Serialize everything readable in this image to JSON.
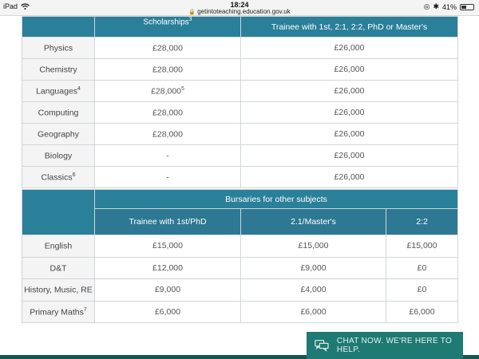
{
  "statusbar": {
    "device": "iPad",
    "time": "18:24",
    "url": "getintoteaching.education.gov.uk",
    "battery": "41%",
    "battery_level": 0.41
  },
  "scholarships_table": {
    "header_partial": "Scholarships",
    "header_partial_note": "3",
    "trainee_header": "Trainee with 1st, 2:1, 2:2, PhD or Master's",
    "rows": [
      {
        "subject": "Physics",
        "note": "",
        "scholarship": "£28,000",
        "scholarship_note": "",
        "bursary": "£26,000"
      },
      {
        "subject": "Chemistry",
        "note": "",
        "scholarship": "£28,000",
        "scholarship_note": "",
        "bursary": "£26,000"
      },
      {
        "subject": "Languages",
        "note": "4",
        "scholarship": "£28,000",
        "scholarship_note": "5",
        "bursary": "£26,000"
      },
      {
        "subject": "Computing",
        "note": "",
        "scholarship": "£28,000",
        "scholarship_note": "",
        "bursary": "£26,000"
      },
      {
        "subject": "Geography",
        "note": "",
        "scholarship": "£28,000",
        "scholarship_note": "",
        "bursary": "£26,000"
      },
      {
        "subject": "Biology",
        "note": "",
        "scholarship": "-",
        "scholarship_note": "",
        "bursary": "£26,000"
      },
      {
        "subject": "Classics",
        "note": "6",
        "scholarship": "-",
        "scholarship_note": "",
        "bursary": "£26,000"
      }
    ]
  },
  "bursaries_table": {
    "title": "Bursaries for other subjects",
    "columns": [
      "Trainee with 1st/PhD",
      "2.1/Master's",
      "2:2"
    ],
    "rows": [
      {
        "subject": "English",
        "note": "",
        "values": [
          "£15,000",
          "£15,000",
          "£15,000"
        ]
      },
      {
        "subject": "D&T",
        "note": "",
        "values": [
          "£12,000",
          "£9,000",
          "£0"
        ]
      },
      {
        "subject": "History, Music, RE",
        "note": "",
        "values": [
          "£9,000",
          "£4,000",
          "£0"
        ]
      },
      {
        "subject": "Primary Maths",
        "note": "7",
        "values": [
          "£6,000",
          "£6,000",
          "£6,000"
        ]
      }
    ]
  },
  "chat": {
    "label": "CHAT NOW. WE'RE HERE TO HELP."
  }
}
